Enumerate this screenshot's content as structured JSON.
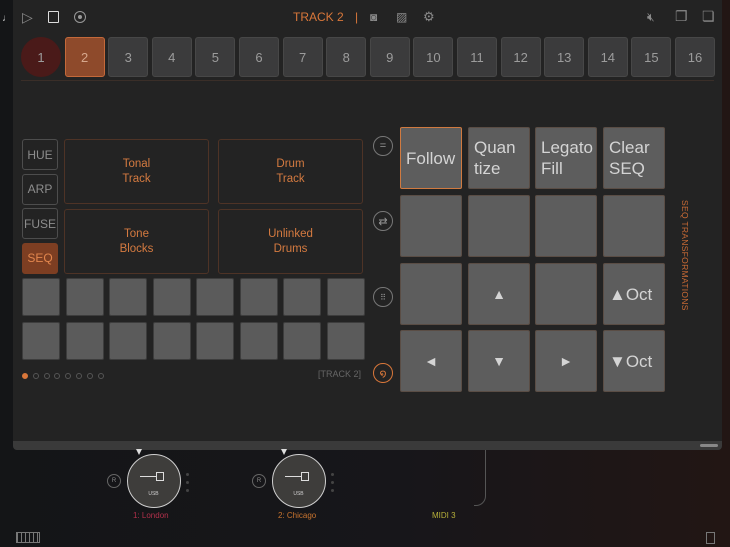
{
  "toolbar": {
    "title": "TRACK 2",
    "separator": "|",
    "icons": [
      "play-icon",
      "stop-icon",
      "record-icon",
      "camera-icon",
      "image-icon",
      "gear-icon",
      "mute-icon",
      "copy-icon",
      "paste-icon"
    ]
  },
  "tracks": [
    "1",
    "2",
    "3",
    "4",
    "5",
    "6",
    "7",
    "8",
    "9",
    "10",
    "11",
    "12",
    "13",
    "14",
    "15",
    "16"
  ],
  "selected_track": "2",
  "modes": [
    "HUE",
    "ARP",
    "FUSE",
    "SEQ"
  ],
  "selected_mode": "SEQ",
  "track_types": [
    "Tonal\nTrack",
    "Drum\nTrack",
    "Tone\nBlocks",
    "Unlinked\nDrums"
  ],
  "page_label": "[TRACK 2]",
  "pages_total": 8,
  "page_active": 1,
  "transform": {
    "buttons": [
      "Follow",
      "Quan\ntize",
      "Legato\nFill",
      "Clear\nSEQ",
      "",
      "",
      "",
      "",
      "",
      "▲",
      "",
      "▲Oct",
      "◄",
      "▼",
      "►",
      "▼Oct"
    ],
    "side_label": "SEQ TRANSFORMATIONS"
  },
  "devices": [
    {
      "name": "1: London",
      "port": "USB",
      "r": "R",
      "color": "#b0304a"
    },
    {
      "name": "2: Chicago",
      "port": "USB",
      "r": "R",
      "color": "#c8742e"
    }
  ],
  "midi3": {
    "name": "MIDI 3",
    "color": "#b7b03a"
  },
  "colors": {
    "accent": "#d9773a"
  }
}
